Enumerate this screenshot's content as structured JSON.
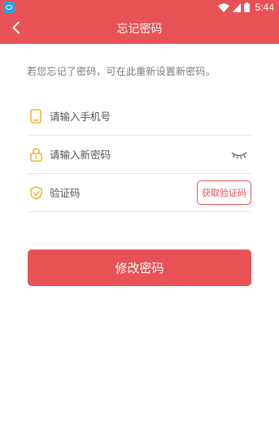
{
  "status_bar": {
    "time": "5:44",
    "icons": [
      "app-icon",
      "wifi-icon",
      "signal-icon",
      "battery-icon"
    ]
  },
  "header": {
    "title": "忘记密码",
    "back_icon": "chevron-left-icon"
  },
  "hint": "若您忘记了密码，可在此重新设置新密码。",
  "form": {
    "phone": {
      "placeholder": "请输入手机号",
      "value": "",
      "icon": "phone-icon"
    },
    "password": {
      "placeholder": "请输入新密码",
      "value": "",
      "icon": "lock-icon",
      "toggle_icon": "eye-closed-icon"
    },
    "code": {
      "placeholder": "验证码",
      "value": "",
      "icon": "shield-icon",
      "button_label": "获取验证码"
    }
  },
  "submit_label": "修改密码",
  "colors": {
    "accent": "#e85255",
    "icon_yellow": "#f2b534",
    "divider": "#e6e6e6"
  }
}
